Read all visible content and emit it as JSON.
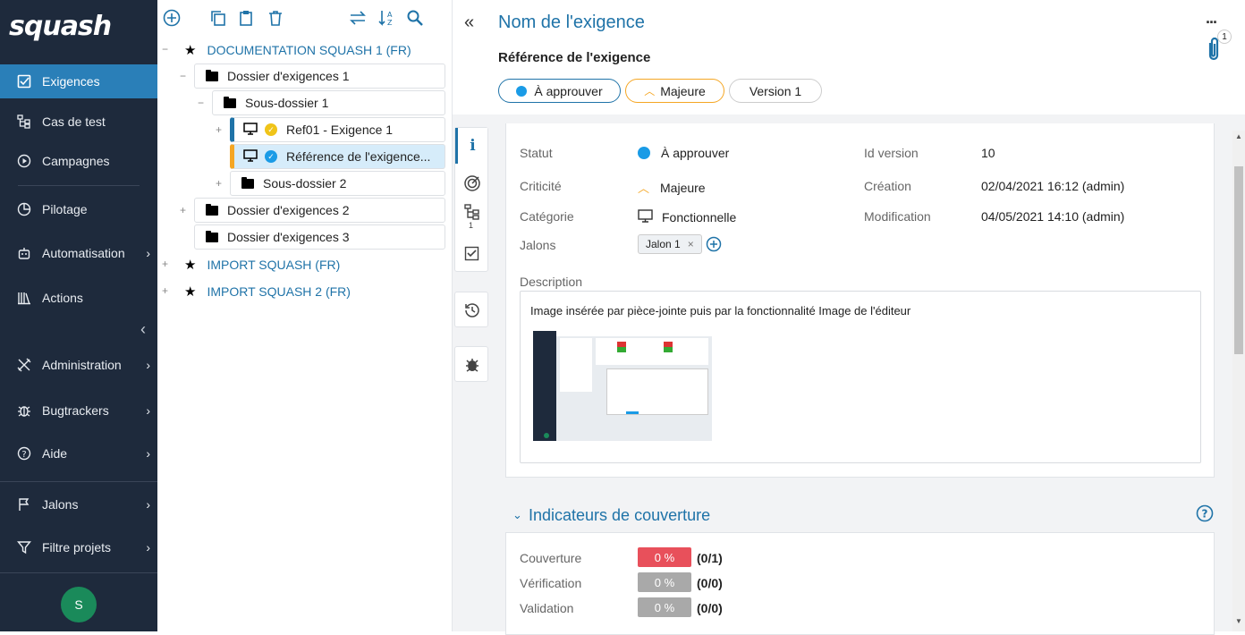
{
  "app": {
    "logo": "squash"
  },
  "nav": [
    {
      "label": "Exigences",
      "icon": "checkbox-icon",
      "active": true
    },
    {
      "label": "Cas de test",
      "icon": "tree-icon"
    },
    {
      "label": "Campagnes",
      "icon": "play-icon"
    },
    {
      "label": "Pilotage",
      "icon": "pie-icon"
    },
    {
      "label": "Automatisation",
      "icon": "robot-icon"
    },
    {
      "label": "Actions",
      "icon": "library-icon"
    },
    {
      "label": "Administration",
      "icon": "tools-icon"
    },
    {
      "label": "Bugtrackers",
      "icon": "bug-icon"
    },
    {
      "label": "Aide",
      "icon": "help-icon"
    },
    {
      "label": "Jalons",
      "icon": "flag-icon"
    },
    {
      "label": "Filtre projets",
      "icon": "filter-icon"
    }
  ],
  "user": {
    "initial": "S"
  },
  "tree": {
    "project1": "DOCUMENTATION SQUASH 1 (FR)",
    "folder1": "Dossier d'exigences 1",
    "subfolder1": "Sous-dossier 1",
    "req1": "Ref01 - Exigence 1",
    "req2": "Référence de l'exigence...",
    "subfolder2": "Sous-dossier 2",
    "folder2": "Dossier d'exigences 2",
    "folder3": "Dossier d'exigences 3",
    "project2": "IMPORT SQUASH (FR)",
    "project3": "IMPORT SQUASH 2 (FR)"
  },
  "header": {
    "title": "Nom de l'exigence",
    "reference": "Référence de l'exigence",
    "status_pill": "À approuver",
    "criticity_pill": "Majeure",
    "version_pill": "Version 1",
    "attach_count": "1",
    "more": "..."
  },
  "vtab_count": "1",
  "info": {
    "statut_label": "Statut",
    "statut_value": "À approuver",
    "criticite_label": "Criticité",
    "criticite_value": "Majeure",
    "categorie_label": "Catégorie",
    "categorie_value": "Fonctionnelle",
    "jalons_label": "Jalons",
    "jalon_tag": "Jalon 1",
    "idversion_label": "Id version",
    "idversion_value": "10",
    "creation_label": "Création",
    "creation_value": "02/04/2021 16:12 (admin)",
    "modif_label": "Modification",
    "modif_value": "04/05/2021 14:10 (admin)",
    "description_label": "Description",
    "description_text": "Image insérée par pièce-jointe puis par la fonctionnalité Image de l'éditeur"
  },
  "coverage": {
    "title": "Indicateurs de couverture",
    "rows": [
      {
        "label": "Couverture",
        "percent": "0 %",
        "ratio": "(0/1)",
        "color": "#e8505b"
      },
      {
        "label": "Vérification",
        "percent": "0 %",
        "ratio": "(0/0)",
        "color": "#a9a9a9"
      },
      {
        "label": "Validation",
        "percent": "0 %",
        "ratio": "(0/0)",
        "color": "#a9a9a9"
      }
    ]
  },
  "colors": {
    "sidebar": "#1e2a3c",
    "accent": "#1f73a8",
    "active": "#2a7fb8",
    "status_blue": "#1a9be6",
    "criticity_orange": "#f5a623",
    "selected_row": "#d6ecfa"
  }
}
